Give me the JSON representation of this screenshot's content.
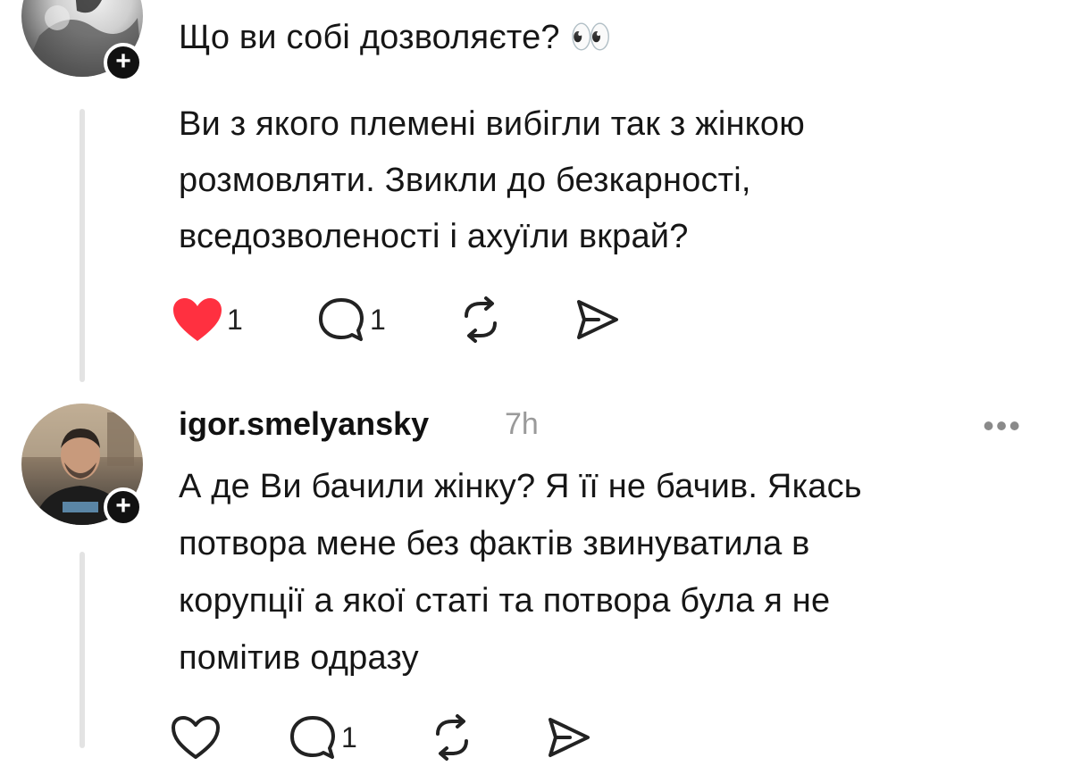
{
  "posts": [
    {
      "line": "Що ви собі дозволяєте? 👀",
      "body": [
        "Ви з якого племені вибігли так з жінкою",
        "розмовляти. Звикли до безкарності,",
        "вседозволеності і ахуїли вкрай?"
      ],
      "likes": "1",
      "liked": true,
      "replies": "1"
    },
    {
      "username": "igor.smelyansky",
      "time": "7h",
      "more": "•••",
      "body": [
        "А де Ви бачили жінку? Я її не бачив. Якась",
        "потвора мене без фактів звинуватила в",
        "корупції а якої статі та потвора була я не",
        "помітив одразу"
      ],
      "likes": "",
      "liked": false,
      "replies": "1"
    }
  ],
  "colors": {
    "heart": "#ff3040",
    "thread": "#e3e3e3",
    "muted": "#9a9a9a"
  },
  "icons": [
    "plus-icon",
    "heart-icon",
    "comment-icon",
    "repost-icon",
    "share-icon",
    "more-icon"
  ]
}
